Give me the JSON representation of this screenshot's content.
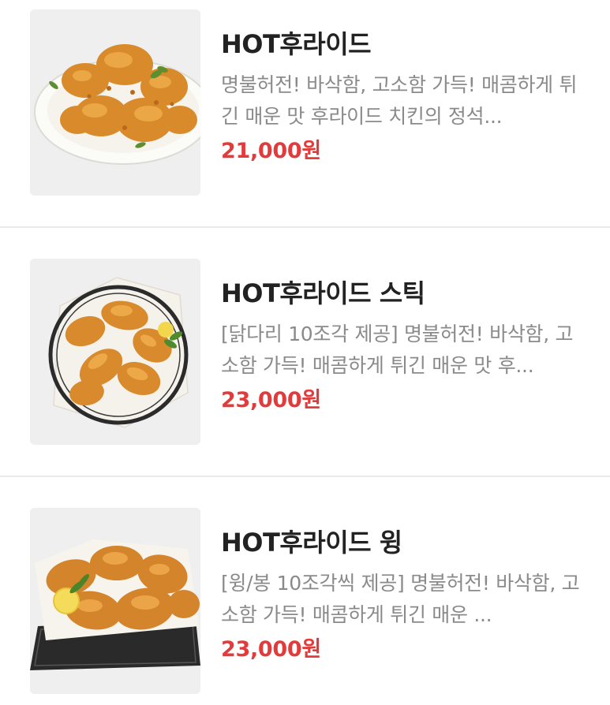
{
  "menu": {
    "items": [
      {
        "name": "HOT후라이드",
        "description": "명불허전! 바삭함, 고소함 가득! 매콤하게 튀긴 매운 맛 후라이드 치킨의 정석...",
        "price": "21,000원",
        "image_icon": "fried-chicken-plate"
      },
      {
        "name": "HOT후라이드 스틱",
        "description": "[닭다리 10조각 제공] 명불허전! 바삭함, 고소함 가득! 매콤하게 튀긴 매운 맛 후...",
        "price": "23,000원",
        "image_icon": "fried-drumsticks-basket"
      },
      {
        "name": "HOT후라이드 윙",
        "description": "[윙/봉 10조각씩 제공] 명불허전! 바삭함, 고소함 가득! 매콤하게 튀긴 매운 ...",
        "price": "23,000원",
        "image_icon": "fried-wings-basket"
      }
    ]
  },
  "colors": {
    "price": "#e33b3b",
    "name": "#222222",
    "description": "#8a8a8a",
    "thumb_bg": "#efefef",
    "divider": "#e9e9e9"
  }
}
